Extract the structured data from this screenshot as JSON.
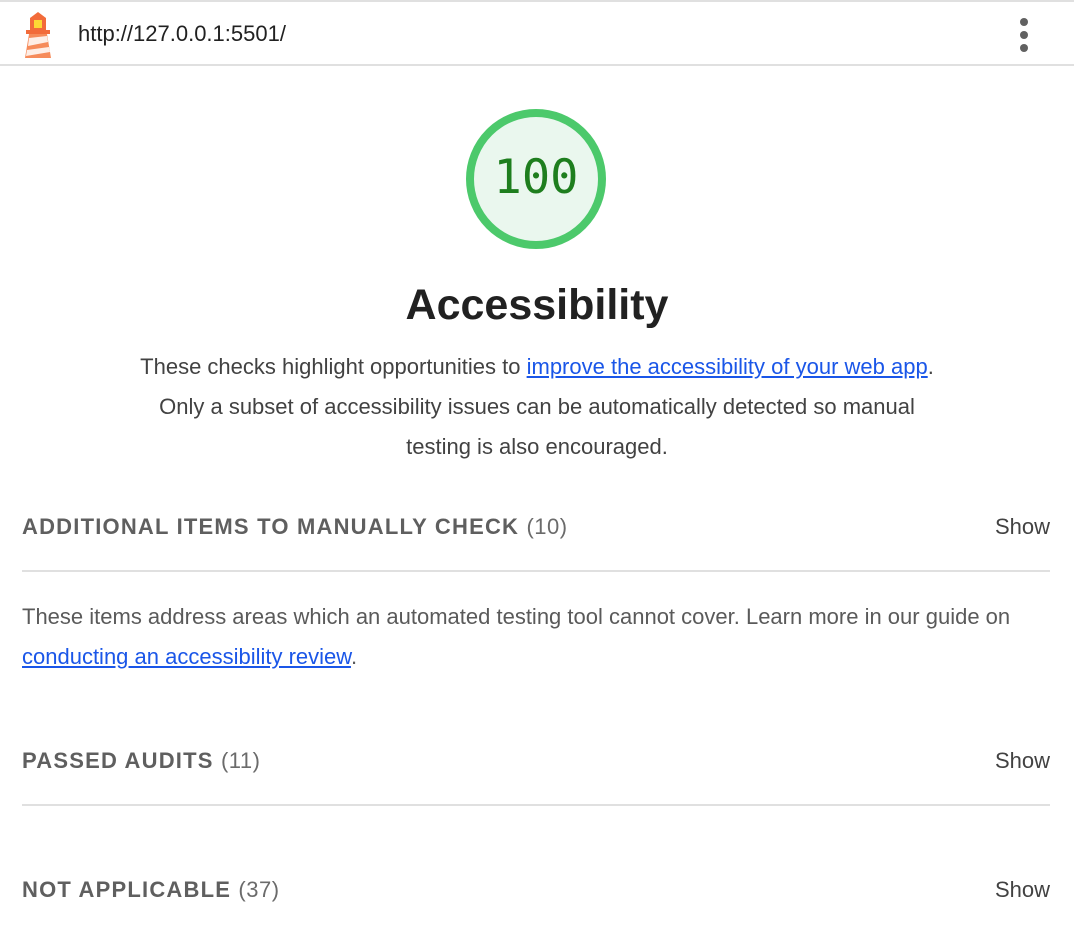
{
  "topbar": {
    "url": "http://127.0.0.1:5501/",
    "logo_icon": "lighthouse-icon",
    "menu_icon": "vertical-dots-icon"
  },
  "gauge": {
    "score": "100",
    "fill_fraction": 1.0,
    "color": "#4cc96b",
    "bg_color": "#eaf7ee",
    "text_color": "#1e7e1e"
  },
  "category": {
    "title": "Accessibility",
    "desc_before": "These checks highlight opportunities to ",
    "desc_link": "improve the accessibility of your web app",
    "desc_after": ". Only a subset of accessibility issues can be automatically detected so manual testing is also encouraged."
  },
  "groups": [
    {
      "title": "ADDITIONAL ITEMS TO MANUALLY CHECK",
      "count": "(10)",
      "toggle": "Show",
      "desc_before": "These items address areas which an automated testing tool cannot cover. Learn more in our guide on ",
      "desc_link": "conducting an accessibility review",
      "desc_after": "."
    },
    {
      "title": "PASSED AUDITS",
      "count": "(11)",
      "toggle": "Show"
    },
    {
      "title": "NOT APPLICABLE",
      "count": "(37)",
      "toggle": "Show"
    }
  ],
  "colors": {
    "link": "#1a56e8",
    "pass": "#4cc96b"
  }
}
